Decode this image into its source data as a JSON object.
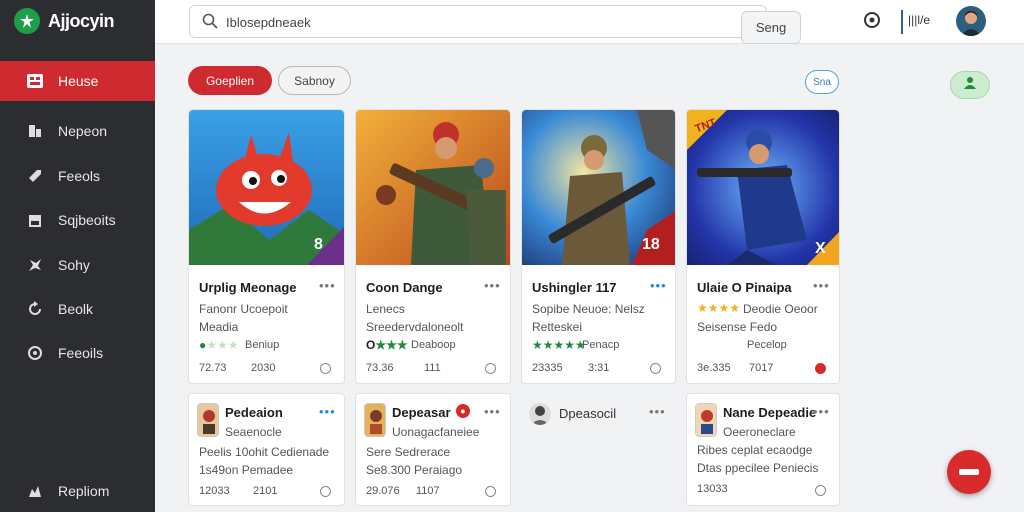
{
  "app": {
    "name": "Ajjocyin"
  },
  "sidebar": {
    "items": [
      {
        "label": "Heuse",
        "icon": "home-icon",
        "active": true
      },
      {
        "label": "Nepeon",
        "icon": "chart-icon"
      },
      {
        "label": "Feeols",
        "icon": "tag-icon"
      },
      {
        "label": "Sqjbeoits",
        "icon": "store-icon"
      },
      {
        "label": "Sohy",
        "icon": "star-icon"
      },
      {
        "label": "Beolk",
        "icon": "refresh-icon"
      },
      {
        "label": "Feeoils",
        "icon": "settings-icon"
      }
    ],
    "footer": {
      "label": "Repliom",
      "icon": "grid-icon"
    }
  },
  "topbar": {
    "search": {
      "value": "Iblosepdneaek"
    },
    "search_button": "Seng",
    "user_label": "|||l/e"
  },
  "filters": {
    "primary": "Goeplien",
    "secondary": "Sabnoy",
    "chat_badge": "Sna"
  },
  "colors": {
    "accent": "#cf2a2f",
    "sidebar": "#2b2d30",
    "star": "#2e9e45",
    "star_gold": "#f2b01e"
  },
  "cards": [
    {
      "title": "Urplig Meonage",
      "line1": "Fanonr Ucoepoit",
      "line2": "Meadia",
      "stars_filled": 1,
      "stars_total": 5,
      "rating_label": "Beniup",
      "meta1": "72.73",
      "meta2": "2030",
      "badge": "8"
    },
    {
      "title": "Coon Dange",
      "line1": "Lenecs",
      "line2": "Sreedervdaloneolt",
      "stars_prefix": "O",
      "stars_filled": 3,
      "stars_total": 3,
      "rating_label": "Deaboop",
      "meta1": "73.36",
      "meta2": "111"
    },
    {
      "title": "Ushingler 117",
      "line1": "Sopibe Neuoe: Nelsz",
      "line2": "Retteskei",
      "stars_filled": 5,
      "stars_total": 5,
      "rating_label": "Penacp",
      "meta1": "23335",
      "meta2": "3:31",
      "badge": "18"
    },
    {
      "title": "Ulaie O Pinaipa",
      "line1": "Deodie Oeoor",
      "line2": "Seisense Fedo",
      "stars_filled": 4,
      "stars_total": 4,
      "rating_label": "Pecelop",
      "meta1": "3e.335",
      "meta2": "7017",
      "badge": "X",
      "tag": "TNT"
    }
  ],
  "lower_cards": [
    {
      "title": "Pedeaion",
      "line1": "Seaenocle",
      "line2": "Peelis 10ohit Cedienade",
      "line3": "1s49on Pemadee",
      "meta1": "12033",
      "meta2": "2101"
    },
    {
      "title": "Depeasar",
      "line1": "Uonagacfaneiee",
      "line2": "Sere Sedrerace",
      "line3": "Se8.300 Peraiago",
      "meta1": "29.076",
      "meta2": "1107"
    },
    {
      "title": "Dpeasocil"
    },
    {
      "title": "Nane Depeadie",
      "line1": "Oeeroneclare",
      "line2": "Ribes ceplat ecaodge",
      "line3": "Dtas ppecilee Peniecis",
      "meta1": "13033"
    }
  ]
}
